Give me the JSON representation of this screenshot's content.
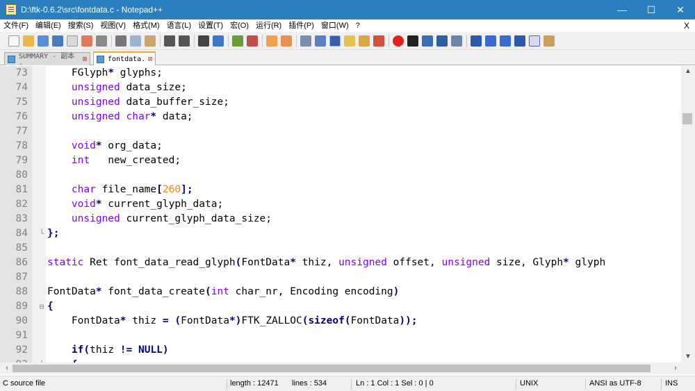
{
  "window": {
    "title": "D:\\ftk-0.6.2\\src\\fontdata.c - Notepad++",
    "buttons": {
      "minimize": "—",
      "maximize": "☐",
      "close": "✕"
    }
  },
  "menu": {
    "items": [
      "文件(F)",
      "编辑(E)",
      "搜索(S)",
      "视图(V)",
      "格式(M)",
      "语言(L)",
      "设置(T)",
      "宏(O)",
      "运行(R)",
      "插件(P)",
      "窗口(W)",
      "?"
    ],
    "close_label": "X"
  },
  "tabs": [
    {
      "label": "SUMMARY - 副本 -"
    },
    {
      "label": "fontdata."
    }
  ],
  "editor": {
    "lines": [
      {
        "num": "73",
        "fold": "",
        "segments": [
          {
            "t": "    FGlyph"
          },
          {
            "t": "*",
            "c": "b"
          },
          {
            "t": " glyphs;"
          }
        ]
      },
      {
        "num": "74",
        "fold": "",
        "segments": [
          {
            "t": "    "
          },
          {
            "t": "unsigned",
            "c": "k"
          },
          {
            "t": " data_size;"
          }
        ]
      },
      {
        "num": "75",
        "fold": "",
        "segments": [
          {
            "t": "    "
          },
          {
            "t": "unsigned",
            "c": "k"
          },
          {
            "t": " data_buffer_size;"
          }
        ]
      },
      {
        "num": "76",
        "fold": "",
        "segments": [
          {
            "t": "    "
          },
          {
            "t": "unsigned",
            "c": "k"
          },
          {
            "t": " "
          },
          {
            "t": "char",
            "c": "k"
          },
          {
            "t": "*",
            "c": "b"
          },
          {
            "t": " data;"
          }
        ]
      },
      {
        "num": "77",
        "fold": "",
        "segments": []
      },
      {
        "num": "78",
        "fold": "",
        "segments": [
          {
            "t": "    "
          },
          {
            "t": "void",
            "c": "k"
          },
          {
            "t": "*",
            "c": "b"
          },
          {
            "t": " org_data;"
          }
        ]
      },
      {
        "num": "79",
        "fold": "",
        "segments": [
          {
            "t": "    "
          },
          {
            "t": "int",
            "c": "k"
          },
          {
            "t": "   new_created;"
          }
        ]
      },
      {
        "num": "80",
        "fold": "",
        "segments": []
      },
      {
        "num": "81",
        "fold": "",
        "segments": [
          {
            "t": "    "
          },
          {
            "t": "char",
            "c": "k"
          },
          {
            "t": " file_name"
          },
          {
            "t": "[",
            "c": "b"
          },
          {
            "t": "260",
            "c": "n"
          },
          {
            "t": "];",
            "c": "b"
          }
        ]
      },
      {
        "num": "82",
        "fold": "",
        "segments": [
          {
            "t": "    "
          },
          {
            "t": "void",
            "c": "k"
          },
          {
            "t": "*",
            "c": "b"
          },
          {
            "t": " current_glyph_data;"
          }
        ]
      },
      {
        "num": "83",
        "fold": "",
        "segments": [
          {
            "t": "    "
          },
          {
            "t": "unsigned",
            "c": "k"
          },
          {
            "t": " current_glyph_data_size;"
          }
        ]
      },
      {
        "num": "84",
        "fold": "└",
        "segments": [
          {
            "t": "};",
            "c": "b"
          }
        ]
      },
      {
        "num": "85",
        "fold": "",
        "segments": []
      },
      {
        "num": "86",
        "fold": "",
        "segments": [
          {
            "t": "static",
            "c": "k"
          },
          {
            "t": " Ret font_data_read_glyph"
          },
          {
            "t": "(",
            "c": "b"
          },
          {
            "t": "FontData"
          },
          {
            "t": "*",
            "c": "b"
          },
          {
            "t": " thiz, "
          },
          {
            "t": "unsigned",
            "c": "k"
          },
          {
            "t": " offset, "
          },
          {
            "t": "unsigned",
            "c": "k"
          },
          {
            "t": " size, Glyph"
          },
          {
            "t": "*",
            "c": "b"
          },
          {
            "t": " glyph"
          }
        ]
      },
      {
        "num": "87",
        "fold": "",
        "segments": []
      },
      {
        "num": "88",
        "fold": "",
        "segments": [
          {
            "t": "FontData"
          },
          {
            "t": "*",
            "c": "b"
          },
          {
            "t": " font_data_create"
          },
          {
            "t": "(",
            "c": "b"
          },
          {
            "t": "int",
            "c": "k"
          },
          {
            "t": " char_nr, Encoding encoding"
          },
          {
            "t": ")",
            "c": "b"
          }
        ]
      },
      {
        "num": "89",
        "fold": "⊟",
        "segments": [
          {
            "t": "{",
            "c": "b"
          }
        ]
      },
      {
        "num": "90",
        "fold": "",
        "segments": [
          {
            "t": "    FontData"
          },
          {
            "t": "*",
            "c": "b"
          },
          {
            "t": " thiz "
          },
          {
            "t": "=",
            "c": "b"
          },
          {
            "t": " "
          },
          {
            "t": "(",
            "c": "b"
          },
          {
            "t": "FontData"
          },
          {
            "t": "*)",
            "c": "b"
          },
          {
            "t": "FTK_ZALLOC"
          },
          {
            "t": "(",
            "c": "b"
          },
          {
            "t": "sizeof",
            "c": "b"
          },
          {
            "t": "(",
            "c": "b"
          },
          {
            "t": "FontData"
          },
          {
            "t": "));",
            "c": "b"
          }
        ]
      },
      {
        "num": "91",
        "fold": "",
        "segments": []
      },
      {
        "num": "92",
        "fold": "",
        "segments": [
          {
            "t": "    "
          },
          {
            "t": "if",
            "c": "b"
          },
          {
            "t": "(",
            "c": "b"
          },
          {
            "t": "thiz "
          },
          {
            "t": "!=",
            "c": "b"
          },
          {
            "t": " "
          },
          {
            "t": "NULL",
            "c": "b"
          },
          {
            "t": ")",
            "c": "b"
          }
        ]
      },
      {
        "num": "93",
        "fold": "├",
        "segments": [
          {
            "t": "    "
          },
          {
            "t": "{",
            "c": "b"
          }
        ]
      }
    ]
  },
  "statusbar": {
    "file_type": "C source file",
    "length": "length : 12471",
    "lines": "lines : 534",
    "position": "Ln : 1    Col : 1    Sel : 0 | 0",
    "eol": "UNIX",
    "encoding": "ANSI as UTF-8",
    "mode": "INS"
  },
  "toolbar": {
    "icons": [
      "new-file",
      "open-file",
      "save",
      "save-all",
      "close",
      "close-all",
      "print",
      "cut",
      "copy",
      "paste",
      "undo",
      "redo",
      "find",
      "replace",
      "zoom-in",
      "zoom-out",
      "sync-vertical",
      "sync-horizontal",
      "word-wrap",
      "show-all-chars",
      "indent-guide",
      "user-defined-language",
      "doc-map",
      "function-list",
      "record-macro",
      "stop-macro",
      "play-macro",
      "run-macro-multiple",
      "save-macro",
      "fold-all",
      "move-up",
      "move-down",
      "unfold-all",
      "spell-check",
      "extra"
    ]
  }
}
